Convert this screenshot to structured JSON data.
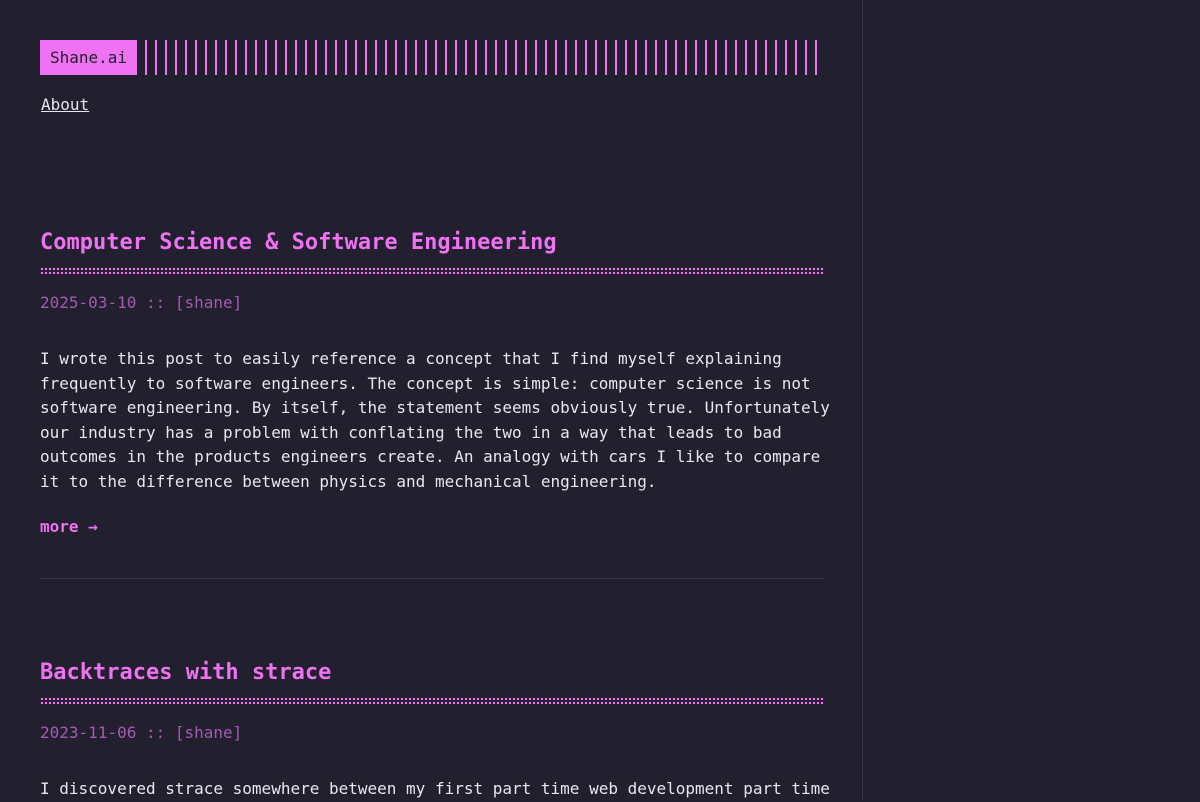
{
  "site": {
    "logo": "Shane.ai",
    "nav": [
      "About"
    ]
  },
  "posts": [
    {
      "title": "Computer Science & Software Engineering",
      "date": "2025-03-10",
      "separator": "::",
      "author": "[shane]",
      "summary": "I wrote this post to easily reference a concept that I find myself explaining frequently to software engineers. The concept is simple: computer science is not software engineering. By itself, the statement seems obviously true. Unfortunately our industry has a problem with conflating the two in a way that leads to bad outcomes in the products engineers create. An analogy with cars I like to compare it to the difference between physics and mechanical engineering.",
      "more_label": "more →"
    },
    {
      "title": "Backtraces with strace",
      "date": "2023-11-06",
      "separator": "::",
      "author": "[shane]",
      "summary": "I discovered strace somewhere between my first part time web development part time"
    }
  ],
  "colors": {
    "background": "#221f2e",
    "accent": "#ee72f1",
    "meta": "#a35bb1",
    "text": "#e8e6ef"
  }
}
